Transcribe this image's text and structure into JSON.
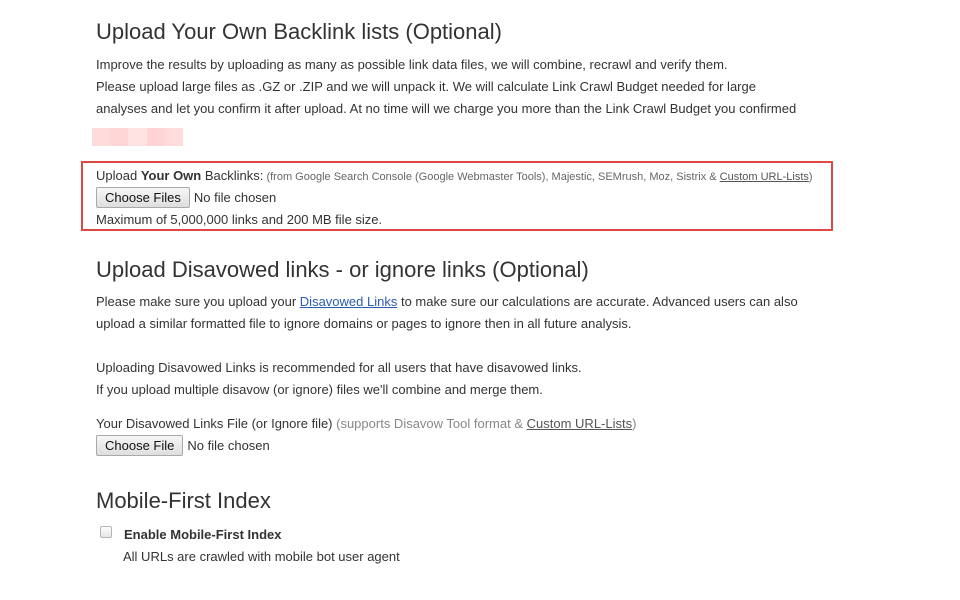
{
  "backlinks_section": {
    "title": "Upload Your Own Backlink lists (Optional)",
    "paragraph_lines": [
      "Improve the results by uploading as many as possible link data files, we will combine, recrawl and verify them.",
      "Please upload large files as .GZ or .ZIP and we will unpack it. We will calculate Link Crawl Budget needed for large",
      "analyses and let you confirm it after upload. At no time will we charge you more than the Link Crawl Budget you confirmed"
    ],
    "redacted_colors": [
      "#ffdcdc",
      "#ffd6d6",
      "#ffe2e2",
      "#ffd4d4",
      "#ffdddd"
    ],
    "upload": {
      "label_prefix": "Upload ",
      "label_bold": "Your Own",
      "label_suffix": " Backlinks:",
      "sources_text": " (from Google Search Console (Google Webmaster Tools), Majestic, SEMrush, Moz, Sistrix & ",
      "custom_link": "Custom URL-Lists",
      "sources_close": ")",
      "button_label": "Choose Files",
      "file_status": "No file chosen",
      "limit_text": "Maximum of 5,000,000 links and 200 MB file size."
    },
    "highlight_color": "#e04848"
  },
  "disavow_section": {
    "title": "Upload Disavowed links - or ignore links (Optional)",
    "line1_prefix": "Please make sure you upload your ",
    "line1_link": "Disavowed Links",
    "line1_suffix": " to make sure our calculations are accurate. Advanced users can also",
    "line2": "upload a similar formatted file to ignore domains or pages to ignore then in all future analysis.",
    "line3": "Uploading Disavowed Links is recommended for all users that have disavowed links.",
    "line4": "If you upload multiple disavow (or ignore) files we'll combine and merge them.",
    "file_label": "Your Disavowed Links File (or Ignore file)",
    "file_hint_prefix": " (supports Disavow Tool format & ",
    "file_hint_link": "Custom URL-Lists",
    "file_hint_close": ")",
    "button_label": "Choose File",
    "file_status": "No file chosen",
    "link_color": "#2a5db0"
  },
  "mobile_section": {
    "title": "Mobile-First Index",
    "checkbox_label": "Enable Mobile-First Index",
    "checkbox_checked": false,
    "description": "All URLs are crawled with mobile bot user agent"
  }
}
